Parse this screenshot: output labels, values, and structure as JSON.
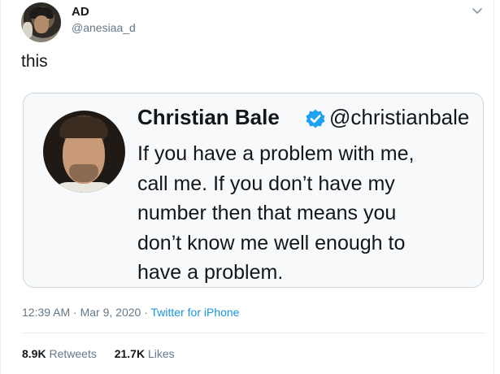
{
  "author": {
    "name": "AD",
    "handle": "@anesiaa_d"
  },
  "tweet": {
    "text": "this"
  },
  "quoted": {
    "name": "Christian Bale",
    "handle": "@christianbale",
    "verified_icon": "verified-badge-icon",
    "lines": [
      "If you have a problem with me,",
      "call me. If you don’t have my",
      "number then that means you",
      "don’t know me well enough to",
      "have a problem."
    ]
  },
  "meta": {
    "time": "12:39 AM",
    "date": "Mar 9, 2020",
    "separator": "·",
    "source": "Twitter for iPhone"
  },
  "stats": {
    "retweets_count": "8.9K",
    "retweets_label": "Retweets",
    "likes_count": "21.7K",
    "likes_label": "Likes"
  },
  "colors": {
    "link": "#1b95e0",
    "muted": "#657786",
    "verified": "#1da1f2"
  }
}
